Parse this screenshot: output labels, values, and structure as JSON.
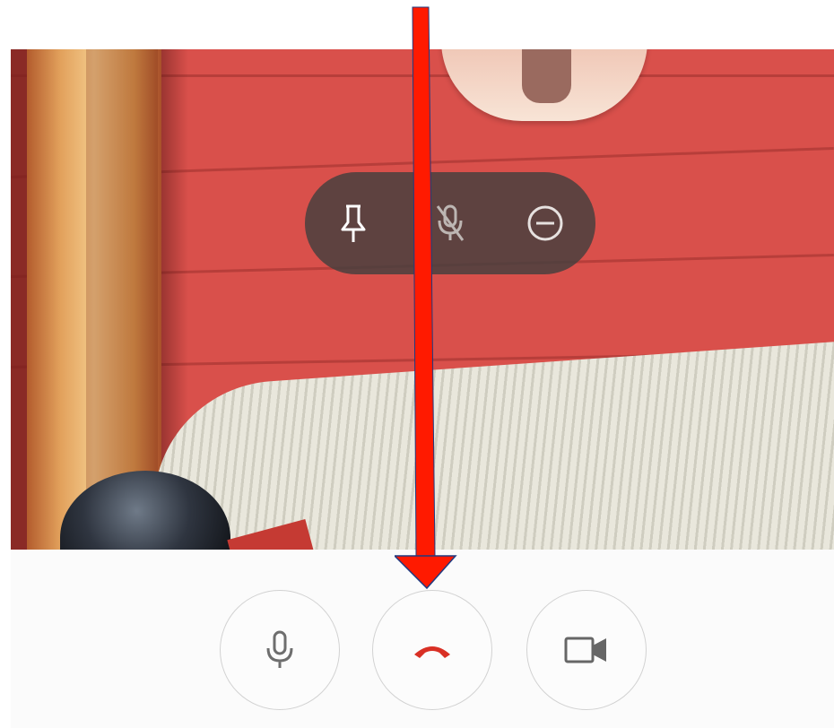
{
  "video": {
    "overlay_controls": [
      {
        "name": "pin",
        "icon": "pin-icon"
      },
      {
        "name": "mute",
        "icon": "mic-off-icon"
      },
      {
        "name": "remove",
        "icon": "minus-circle-icon"
      }
    ]
  },
  "call_controls": [
    {
      "name": "microphone",
      "icon": "microphone-icon"
    },
    {
      "name": "end-call",
      "icon": "hang-up-icon",
      "color": "#d93025"
    },
    {
      "name": "camera",
      "icon": "video-camera-icon"
    }
  ],
  "annotation": {
    "type": "arrow",
    "color": "#ff1a00",
    "points_to": "end-call"
  }
}
